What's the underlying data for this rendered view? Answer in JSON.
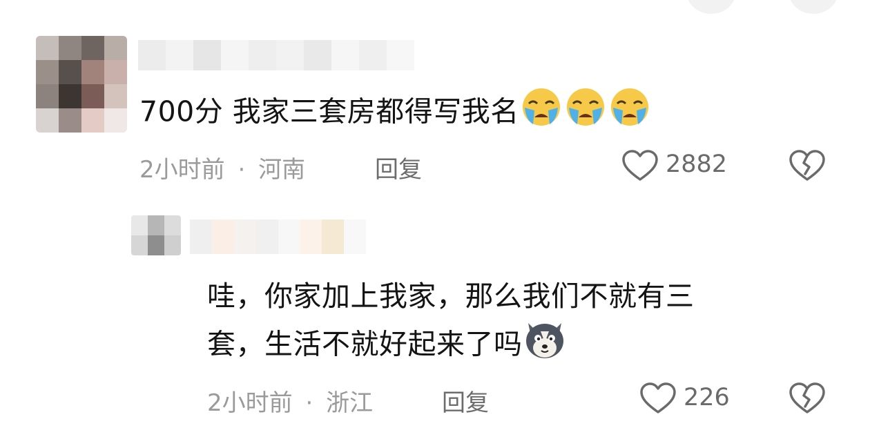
{
  "comments": [
    {
      "text": "700分 我家三套房都得写我名",
      "emojis": [
        "loudly-crying-face-emoji",
        "loudly-crying-face-emoji",
        "loudly-crying-face-emoji"
      ],
      "time": "2小时前",
      "separator": "·",
      "location": "河南",
      "reply_label": "回复",
      "likes": "2882"
    },
    {
      "text_line1": "哇，你家加上我家，那么我们不就有三",
      "text_line2": "套，生活不就好起来了吗",
      "emojis": [
        "husky-dog-emoji"
      ],
      "time": "2小时前",
      "separator": "·",
      "location": "浙江",
      "reply_label": "回复",
      "likes": "226"
    }
  ],
  "colors": {
    "text": "#141414",
    "meta": "#9a9a9a",
    "reply": "#6c6c6c",
    "icon": "#6a6a6a"
  }
}
